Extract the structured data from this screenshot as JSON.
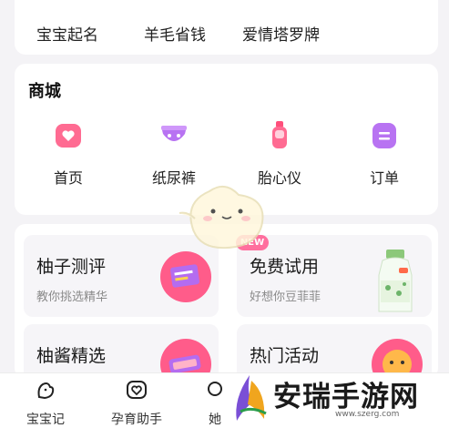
{
  "top_row": [
    "宝宝起名",
    "羊毛省钱",
    "爱情塔罗牌"
  ],
  "shop": {
    "title": "商城",
    "items": [
      {
        "label": "首页",
        "icon": "home-heart-icon"
      },
      {
        "label": "纸尿裤",
        "icon": "diaper-icon"
      },
      {
        "label": "胎心仪",
        "icon": "fetal-monitor-icon"
      },
      {
        "label": "订单",
        "icon": "order-icon"
      }
    ]
  },
  "features": [
    {
      "title": "柚子测评",
      "subtitle": "教你挑选精华"
    },
    {
      "title": "免费试用",
      "subtitle": "好想你豆菲菲"
    },
    {
      "title": "柚酱精选",
      "subtitle": ""
    },
    {
      "title": "热门活动",
      "subtitle": ""
    }
  ],
  "new_badge": "NEW",
  "bottom_nav": [
    {
      "label": "宝宝记",
      "icon": "baby-icon"
    },
    {
      "label": "孕育助手",
      "icon": "heart-chat-icon"
    },
    {
      "label": "她",
      "icon": "she-icon"
    }
  ],
  "watermark": {
    "text": "安瑞手游网",
    "url": "www.szerg.com"
  },
  "colors": {
    "accent_pink": "#ff5c8a",
    "accent_purple": "#b46cf0",
    "background": "#f4f3f6"
  }
}
